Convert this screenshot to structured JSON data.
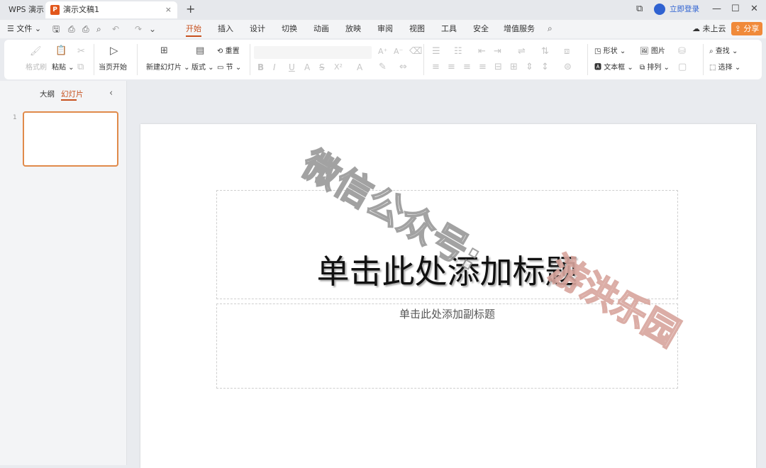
{
  "titlebar": {
    "app_tab": "WPS 演示",
    "doc_tab": "演示文稿1",
    "doc_logo": "P",
    "close": "×",
    "new_tab": "+",
    "login": "立即登录"
  },
  "menubar": {
    "file": "文件",
    "tabs": [
      "开始",
      "插入",
      "设计",
      "切换",
      "动画",
      "放映",
      "审阅",
      "视图",
      "工具",
      "安全",
      "增值服务"
    ],
    "cloud": "未上云",
    "share": "分享"
  },
  "ribbon": {
    "format_painter": "格式刷",
    "paste": "粘贴",
    "from_current": "当页开始",
    "new_slide": "新建幻灯片",
    "layout": "版式",
    "reset": "重置",
    "section": "节",
    "shape": "形状",
    "picture": "图片",
    "textbox": "文本框",
    "arrange": "排列",
    "find": "查找",
    "select": "选择"
  },
  "sidebar": {
    "outline_tab": "大纲",
    "slides_tab": "幻灯片",
    "slide_number": "1"
  },
  "slide": {
    "title_placeholder": "单击此处添加标题",
    "subtitle_placeholder": "单击此处添加副标题"
  },
  "watermark": {
    "line1": "微信公众号:",
    "line2": "游洪乐园"
  },
  "colors": {
    "accent": "#c7511f",
    "share_bg": "#f08a3a",
    "login_blue": "#2f62d1"
  }
}
